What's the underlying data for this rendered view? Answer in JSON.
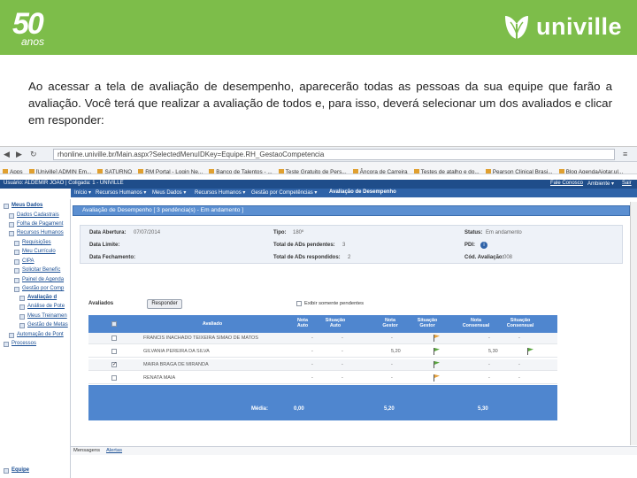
{
  "header": {
    "logo_number": "50",
    "logo_word": "anos",
    "brand": "univille"
  },
  "intro_text": "Ao acessar a tela de avaliação de desempenho, aparecerão todas as pessoas da sua equipe que farão a avaliação. Você terá que realizar a avaliação de todos e, para isso, deverá selecionar um dos avaliados e clicar em responder:",
  "browser": {
    "url": "rhonline.univille.br/Main.aspx?SelectedMenuIDKey=Equipe.RH_GestaoCompetencia",
    "bookmarks": [
      "Apps",
      "[Univille] ADMIN Em...",
      "SATURNO",
      "RM Portal - Login Ne...",
      "Banco de Talentos - ...",
      "Teste Gratuito de Pers...",
      "Âncora de Carreira",
      "Testes de atalho e do...",
      "Pearson Clinical Brasi...",
      "Blog AgendaAjotar.ul..."
    ]
  },
  "app": {
    "user_bar": "Usuário: ALDEMIR JOÃO | Coligada: 1 - UNIVILLE",
    "fale_conosco": "Fale Conosco",
    "ambiente": "Ambiente ▾",
    "sair": "Sair",
    "menu": [
      "Início ▾",
      "Recursos Humanos ▾",
      "Meus Dados ▾",
      "Recursos Humanos ▾",
      "Gestão por Competências ▾",
      "Avaliação de Desempenho"
    ],
    "tree": [
      "Meus Dados",
      "Dados Cadastrais",
      "Folha de Pagament",
      "Recursos Humanos",
      "Requisições",
      "Meu Currículo",
      "CIPA",
      "Solicitar Benefíc",
      "Painel de Agenda",
      "Gestão por Comp",
      "Avaliação d",
      "Análise de Pote",
      "Meus Treinamen",
      "Gestão de Metas",
      "Automação de Pont",
      "Processos",
      "Equipe"
    ]
  },
  "panel": {
    "title": "Avaliação de Desempenho [ 3 pendência(s) - Em andamento ]",
    "data_abertura_label": "Data Abertura:",
    "data_abertura": "07/07/2014",
    "data_limite_label": "Data Limite:",
    "data_fechamento_label": "Data Fechamento:",
    "tipo_label": "Tipo:",
    "tipo": "180º",
    "total_pendentes_label": "Total de ADs pendentes:",
    "total_pendentes": "3",
    "total_respondidos_label": "Total de ADs respondidos:",
    "total_respondidos": "2",
    "status_label": "Status:",
    "status": "Em andamento",
    "pdi_label": "PDI:",
    "cod_label": "Cód. Avaliação:",
    "cod": "008"
  },
  "avaliados": {
    "label": "Avaliados",
    "responder": "Responder",
    "only_pending": "Exibir somente pendentes",
    "columns": [
      "Avaliado",
      "Nota Auto",
      "Situação Auto",
      "Nota Gestor",
      "Situação Gestor",
      "Nota Consensual",
      "Situação Consensual"
    ],
    "rows": [
      {
        "name": "FRANCIS INACHADO TEIXEIRA SIMAO DE MATOS",
        "nota_auto": "-",
        "sit_auto": "-",
        "nota_gestor": "-",
        "nota_cons": "-",
        "sit_cons": "-",
        "checked": false,
        "flag_gestor": "#e8a23a",
        "flag_cons": ""
      },
      {
        "name": "GILVANIA PEREIRA DA SILVA",
        "nota_auto": "-",
        "sit_auto": "-",
        "nota_gestor": "5,20",
        "nota_cons": "5,30",
        "sit_cons": "",
        "checked": false,
        "flag_gestor": "#5aa640",
        "flag_cons": "#5aa640"
      },
      {
        "name": "MAIRA BRAGA DE MIRANDA",
        "nota_auto": "-",
        "sit_auto": "-",
        "nota_gestor": "-",
        "nota_cons": "-",
        "sit_cons": "-",
        "checked": true,
        "flag_gestor": "#5aa640",
        "flag_cons": ""
      },
      {
        "name": "RENATA MAIA",
        "nota_auto": "-",
        "sit_auto": "-",
        "nota_gestor": "-",
        "nota_cons": "-",
        "sit_cons": "-",
        "checked": false,
        "flag_gestor": "#e8a23a",
        "flag_cons": ""
      }
    ],
    "media_label": "Média:",
    "media_auto": "0,00",
    "media_gestor": "5,20",
    "media_cons": "5,30"
  },
  "bottom_tabs": [
    "Mensagens",
    "Alertas"
  ]
}
